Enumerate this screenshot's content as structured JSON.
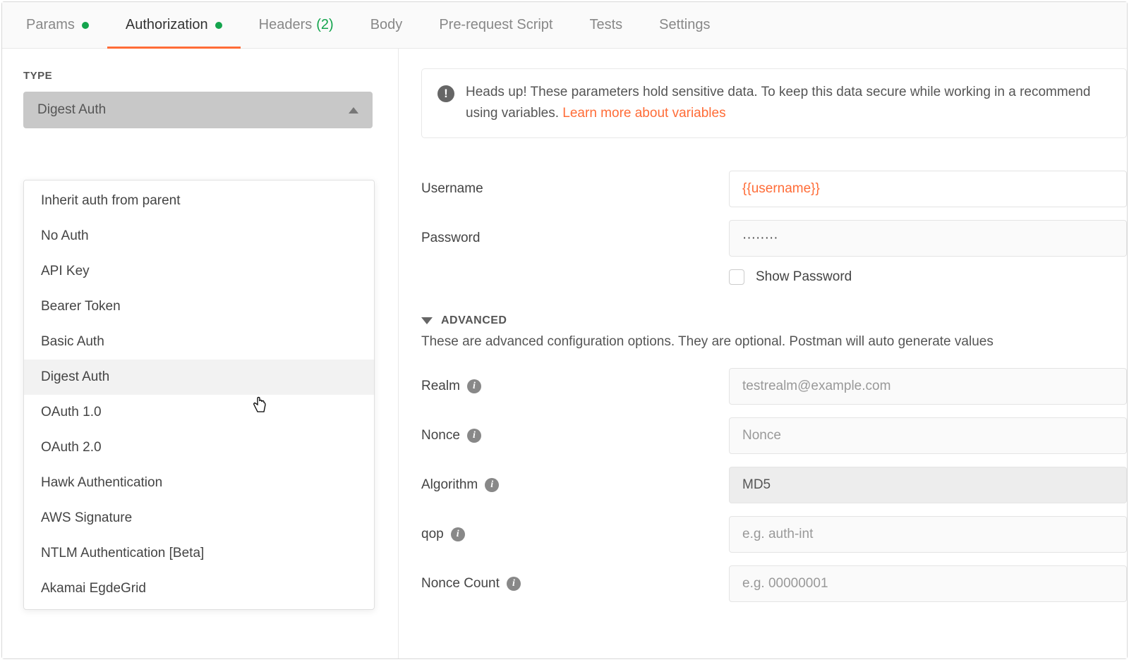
{
  "tabs": {
    "params": "Params",
    "authorization": "Authorization",
    "headers": "Headers",
    "headers_count": "(2)",
    "body": "Body",
    "prerequest": "Pre-request Script",
    "tests": "Tests",
    "settings": "Settings"
  },
  "left": {
    "type_label": "TYPE",
    "selected": "Digest Auth",
    "options": [
      "Inherit auth from parent",
      "No Auth",
      "API Key",
      "Bearer Token",
      "Basic Auth",
      "Digest Auth",
      "OAuth 1.0",
      "OAuth 2.0",
      "Hawk Authentication",
      "AWS Signature",
      "NTLM Authentication [Beta]",
      "Akamai EgdeGrid"
    ]
  },
  "banner": {
    "text_before": "Heads up! These parameters hold sensitive data. To keep this data secure while working in a recommend using variables. ",
    "link": "Learn more about variables"
  },
  "form": {
    "username_label": "Username",
    "username_value": "{{username}}",
    "password_label": "Password",
    "password_value": "········",
    "show_password": "Show Password"
  },
  "advanced": {
    "title": "ADVANCED",
    "desc": "These are advanced configuration options. They are optional. Postman will auto generate values ",
    "realm_label": "Realm",
    "realm_placeholder": "testrealm@example.com",
    "nonce_label": "Nonce",
    "nonce_placeholder": "Nonce",
    "algorithm_label": "Algorithm",
    "algorithm_value": "MD5",
    "qop_label": "qop",
    "qop_placeholder": "e.g. auth-int",
    "nonce_count_label": "Nonce Count",
    "nonce_count_placeholder": "e.g. 00000001"
  }
}
